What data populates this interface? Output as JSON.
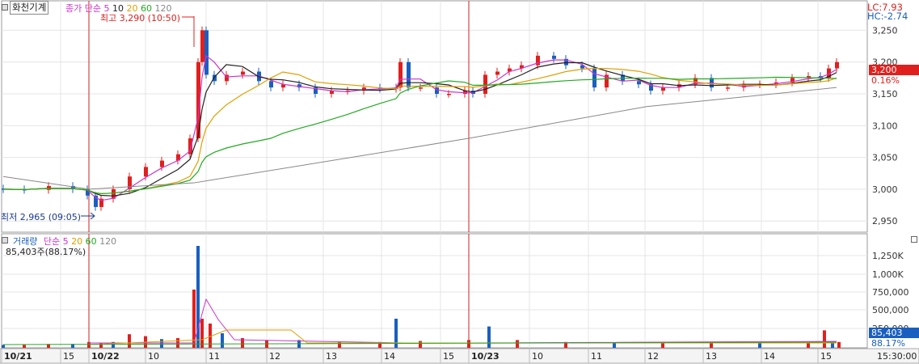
{
  "stock_name": "화천기계",
  "price_legend": {
    "label": "종가 단순",
    "periods": [
      "5",
      "10",
      "20",
      "60",
      "120"
    ],
    "colors": [
      "#cc33cc",
      "#222222",
      "#e0a000",
      "#22aa22",
      "#888888"
    ]
  },
  "lc": "LC:7.93",
  "hc": "HC:-2.74",
  "high_label": "최고 3,290 (10:50)",
  "low_label": "최저 2,965 (09:05)",
  "current_price": "3,200",
  "current_pct": "0.16%",
  "volume_legend": {
    "label": "거래량",
    "ma_label": "단순",
    "periods": [
      "5",
      "20",
      "60",
      "120"
    ],
    "colors": [
      "#cc33cc",
      "#e0a000",
      "#22aa22",
      "#888888"
    ]
  },
  "volume_info": "85,403주(88.17%)",
  "current_volume": "85,403",
  "current_volume_pct": "88.17%",
  "time_label": "15:30:00",
  "colors": {
    "up": "#e0201e",
    "down": "#1a5fbf",
    "grid": "#e4e4e4",
    "session": "#cc2222"
  },
  "chart_data": [
    {
      "type": "candlestick",
      "y_ticks": [
        2950,
        3000,
        3050,
        3100,
        3150,
        3200,
        3250
      ],
      "ylim": [
        2935,
        3290
      ],
      "x_labels": [
        "10/21",
        "15",
        "10/22",
        "10",
        "11",
        "12",
        "13",
        "14",
        "15",
        "10/23",
        "10",
        "11",
        "12",
        "13",
        "14",
        "15"
      ],
      "session_starts": [
        "10/22",
        "10/23"
      ],
      "max_price": 3290,
      "min_price": 2965,
      "current_price": 3200,
      "moving_averages": [
        "5",
        "10",
        "20",
        "60",
        "120"
      ]
    },
    {
      "type": "bar",
      "title": "거래량",
      "y_ticks": [
        "250,000",
        "500,000",
        "750,000",
        "1,000K",
        "1,250K"
      ],
      "ylim": [
        0,
        1400000
      ],
      "current_volume": 85403
    }
  ]
}
